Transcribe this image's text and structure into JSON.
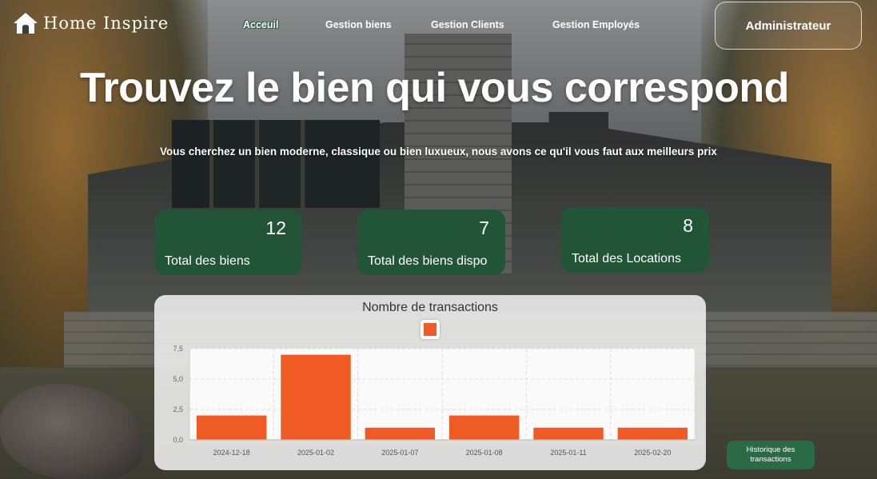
{
  "header": {
    "brand": "Home Inspire",
    "nav": [
      {
        "label": "Acceuil",
        "active": true
      },
      {
        "label": "Gestion biens",
        "active": false
      },
      {
        "label": "Gestion Clients",
        "active": false
      },
      {
        "label": "Gestion Employés",
        "active": false
      }
    ],
    "admin_label": "Administrateur"
  },
  "hero": {
    "title": "Trouvez le bien qui vous correspond",
    "subtitle": "Vous cherchez un bien moderne, classique ou bien luxueux, nous avons ce qu'il vous faut aux meilleurs prix"
  },
  "stats": [
    {
      "value": "12",
      "label": "Total des biens"
    },
    {
      "value": "7",
      "label": "Total des biens dispo"
    },
    {
      "value": "8",
      "label": "Total des Locations"
    }
  ],
  "chart_data": {
    "type": "bar",
    "title": "Nombre de transactions",
    "categories": [
      "2024-12-18",
      "2025-01-02",
      "2025-01-07",
      "2025-01-08",
      "2025-01-11",
      "2025-02-20"
    ],
    "series": [
      {
        "values": [
          2,
          7,
          1,
          2,
          1,
          1
        ]
      }
    ],
    "color": "#f05a24",
    "ylim": [
      0,
      7.5
    ],
    "yticks": [
      "0,0",
      "2,5",
      "5,0",
      "7,5"
    ],
    "ytick_values": [
      0,
      2.5,
      5,
      7.5
    ],
    "grid": true,
    "legend": "top-center"
  },
  "history_button": "Historique des transactions",
  "colors": {
    "card_green": "#225438",
    "button_green": "#2a6b45",
    "bar_orange": "#f05a24"
  }
}
